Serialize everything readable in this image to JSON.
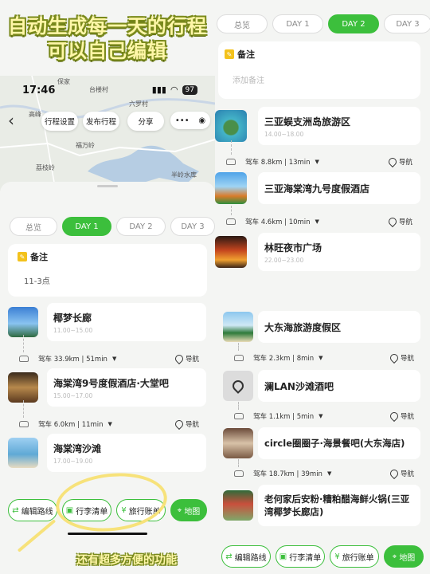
{
  "headline": {
    "line1": "自动生成每一天的行程",
    "line2": "可以自己编辑"
  },
  "footer_note": "还有超多方便的功能",
  "colors": {
    "accent": "#3cbf3c",
    "note": "#f3c21c"
  },
  "status_bar": {
    "time": "17:46",
    "battery": "97"
  },
  "map": {
    "labels": [
      "保家",
      "台楼村",
      "六罗村",
      "高峰",
      "福万岭",
      "荔枝岭",
      "半岭水库"
    ],
    "buttons": {
      "settings": "行程设置",
      "publish": "发布行程",
      "share": "分享"
    }
  },
  "tabs": [
    "总览",
    "DAY 1",
    "DAY 2",
    "DAY 3"
  ],
  "left": {
    "note": {
      "title": "备注",
      "text": "11-3点"
    },
    "places": [
      {
        "name": "椰梦长廊",
        "time": "11.00~15.00"
      },
      {
        "name": "海棠湾9号度假酒店·大堂吧",
        "time": "15.00~17.00"
      },
      {
        "name": "海棠湾沙滩",
        "time": "17.00~19.00"
      }
    ],
    "routes": [
      {
        "text": "驾车 33.9km | 51min",
        "nav": "导航"
      },
      {
        "text": "驾车 6.0km | 11min",
        "nav": "导航"
      }
    ]
  },
  "right_top": {
    "note": {
      "title": "备注",
      "placeholder": "添加备注"
    },
    "places": [
      {
        "name": "三亚蜈支洲岛旅游区",
        "time": "14.00~18.00"
      },
      {
        "name": "三亚海棠湾九号度假酒店",
        "time": ""
      },
      {
        "name": "林旺夜市广场",
        "time": "22.00~23.00"
      }
    ],
    "routes": [
      {
        "text": "驾车 8.8km | 13min",
        "nav": "导航"
      },
      {
        "text": "驾车 4.6km | 10min",
        "nav": "导航"
      }
    ]
  },
  "right_bottom": {
    "places": [
      {
        "name": "大东海旅游度假区"
      },
      {
        "name": "澜LAN沙滩酒吧"
      },
      {
        "name": "circle圈圈子·海景餐吧(大东海店)"
      },
      {
        "name": "老何家后安粉·糟粕醋海鲜火锅(三亚湾椰梦长廊店)"
      }
    ],
    "routes": [
      {
        "text": "驾车 2.3km | 8min",
        "nav": "导航"
      },
      {
        "text": "驾车 1.1km | 5min",
        "nav": "导航"
      },
      {
        "text": "驾车 18.7km | 39min",
        "nav": "导航"
      }
    ]
  },
  "bottom_bar": {
    "edit_route": "编辑路线",
    "luggage": "行李清单",
    "bill": "旅行账单",
    "map": "地图"
  }
}
